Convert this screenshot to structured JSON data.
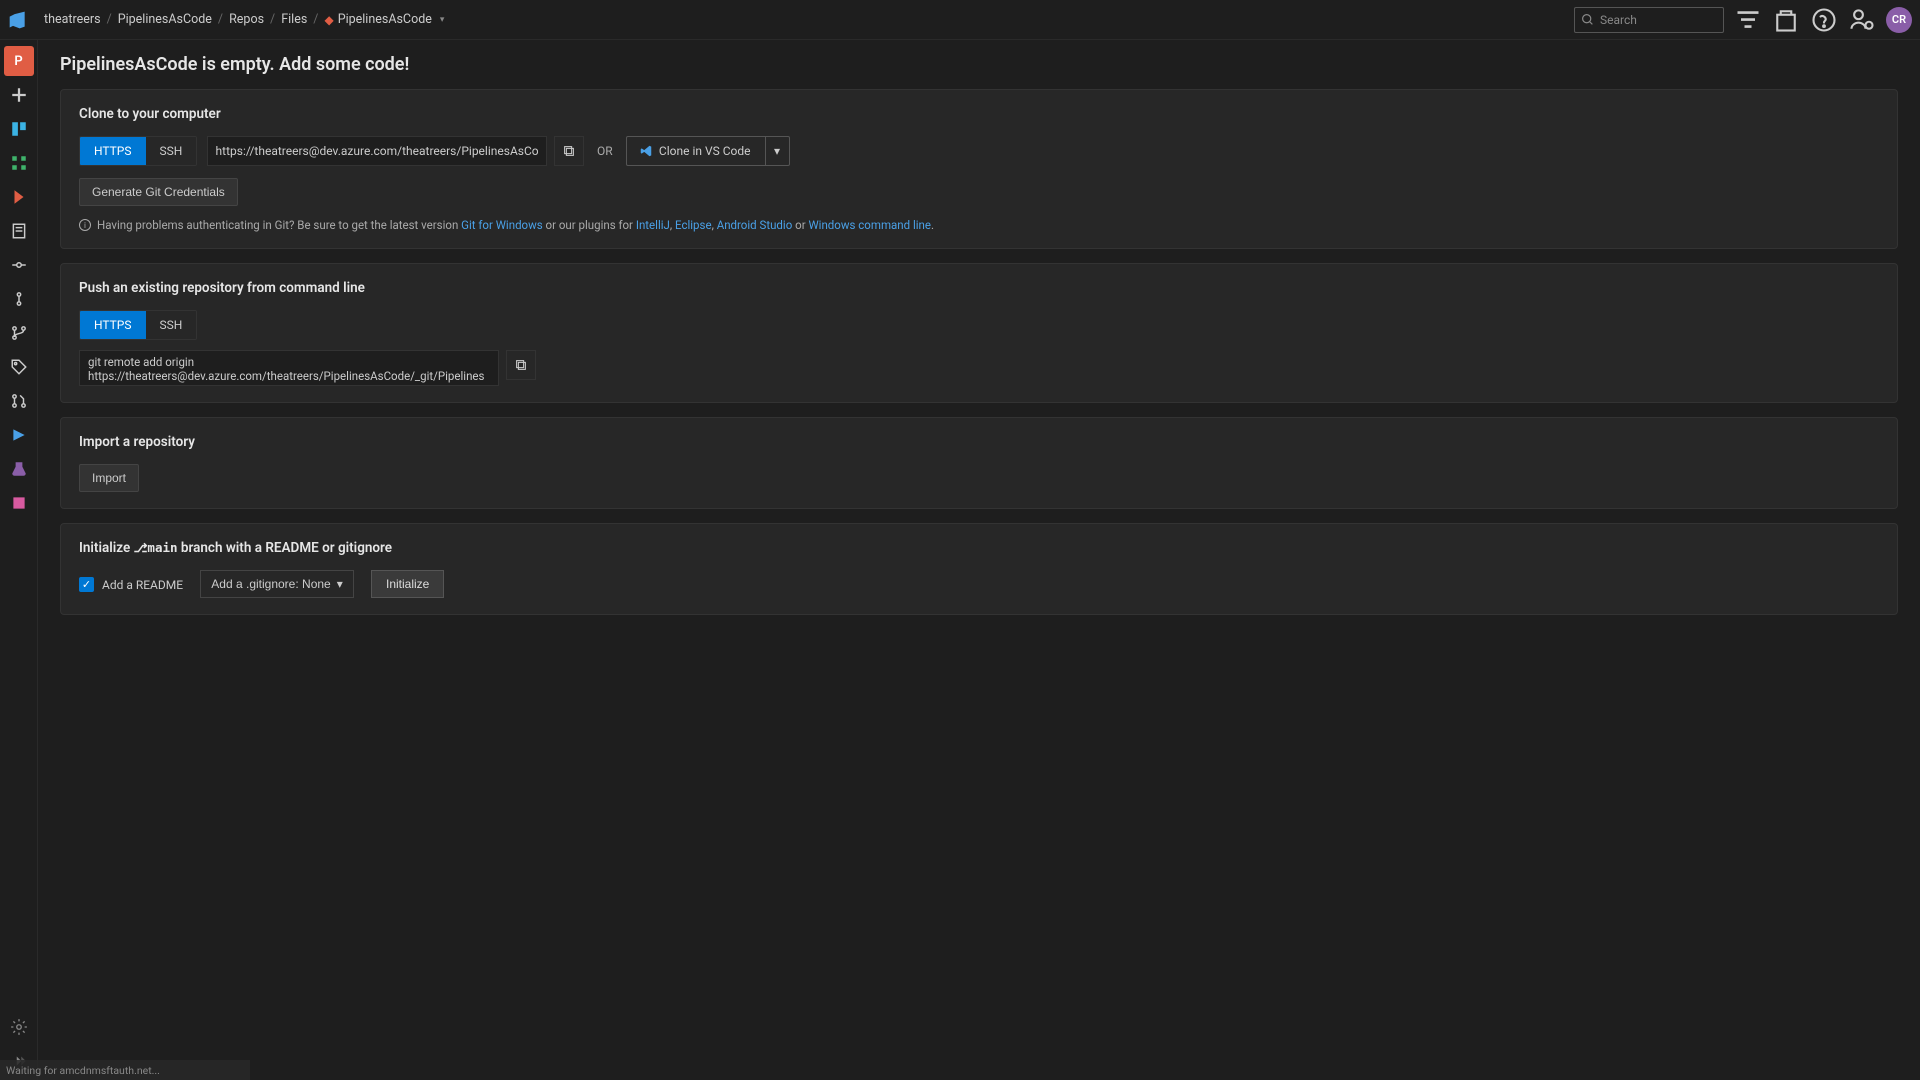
{
  "breadcrumbs": {
    "org": "theatreers",
    "project": "PipelinesAsCode",
    "section": "Repos",
    "subsection": "Files",
    "repo": "PipelinesAsCode"
  },
  "search": {
    "placeholder": "Search"
  },
  "avatar": {
    "initials": "CR"
  },
  "page": {
    "title": "PipelinesAsCode is empty. Add some code!"
  },
  "clone": {
    "title": "Clone to your computer",
    "tabs": {
      "https": "HTTPS",
      "ssh": "SSH"
    },
    "url": "https://theatreers@dev.azure.com/theatreers/PipelinesAsCode/_git/F",
    "or": "OR",
    "clone_btn": "Clone in VS Code",
    "gen_creds": "Generate Git Credentials",
    "help_prefix": "Having problems authenticating in Git? Be sure to get the latest version ",
    "link_git_win": "Git for Windows",
    "help_mid": " or our plugins for ",
    "link_intellij": "IntelliJ",
    "comma1": ", ",
    "link_eclipse": "Eclipse",
    "comma2": ", ",
    "link_android": "Android Studio",
    "or2": " or ",
    "link_wincmd": "Windows command line",
    "period": "."
  },
  "push": {
    "title": "Push an existing repository from command line",
    "tabs": {
      "https": "HTTPS",
      "ssh": "SSH"
    },
    "commands": "git remote add origin\nhttps://theatreers@dev.azure.com/theatreers/PipelinesAsCode/_git/PipelinesAsCode"
  },
  "import": {
    "title": "Import a repository",
    "button": "Import"
  },
  "init": {
    "title_pre": "Initialize ",
    "branch": "main",
    "title_post": " branch with a README or gitignore",
    "readme_label": "Add a README",
    "gitignore_label": "Add a .gitignore: None",
    "button": "Initialize"
  },
  "statusbar": {
    "text": "Waiting for amcdnmsftauth.net..."
  },
  "sidebar": {
    "project_letter": "P"
  }
}
